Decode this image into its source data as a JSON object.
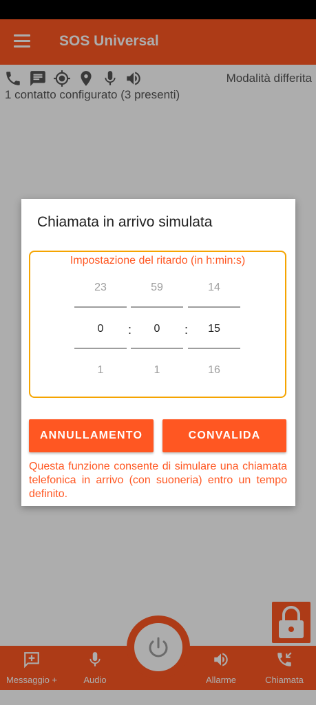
{
  "app": {
    "title": "SOS Universal"
  },
  "status": {
    "mode": "Modalità differita",
    "contacts": "1 contatto configurato (3 presenti)",
    "icons": [
      "phone-icon",
      "message-icon",
      "gps-target-icon",
      "location-pin-icon",
      "microphone-icon",
      "speaker-icon"
    ]
  },
  "dialog": {
    "title": "Chiamata in arrivo simulata",
    "picker_label": "Impostazione del ritardo (in h:min:s)",
    "separator": ":",
    "hours": {
      "prev": "23",
      "current": "0",
      "next": "1"
    },
    "minutes": {
      "prev": "59",
      "current": "0",
      "next": "1"
    },
    "seconds": {
      "prev": "14",
      "current": "15",
      "next": "16"
    },
    "cancel_label": "ANNULLAMENTO",
    "confirm_label": "CONVALIDA",
    "description": "Questa funzione consente di simulare una chiamata telefonica in arrivo (con suoneria) entro un tempo definito."
  },
  "bottom_nav": [
    {
      "label": "Messaggio +",
      "icon": "add-message-icon"
    },
    {
      "label": "Audio",
      "icon": "microphone-icon"
    },
    {
      "label": "Allarme",
      "icon": "speaker-icon"
    },
    {
      "label": "Chiamata",
      "icon": "incoming-call-icon"
    }
  ],
  "colors": {
    "accent": "#ff5722",
    "picker_border": "#f5a400",
    "scrim": "rgba(0,0,0,0.32)"
  }
}
